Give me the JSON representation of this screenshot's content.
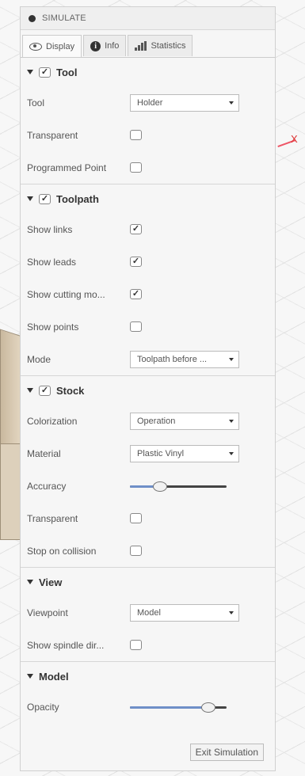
{
  "panel_title": "SIMULATE",
  "tabs": [
    {
      "label": "Display",
      "icon": "eye-icon"
    },
    {
      "label": "Info",
      "icon": "info-icon"
    },
    {
      "label": "Statistics",
      "icon": "bar-chart-icon"
    }
  ],
  "viewport": {
    "axis_label": "X"
  },
  "tool": {
    "title": "Tool",
    "checked": true,
    "tool_label": "Tool",
    "tool_value": "Holder",
    "transparent_label": "Transparent",
    "programmed_point_label": "Programmed Point"
  },
  "toolpath": {
    "title": "Toolpath",
    "checked": true,
    "show_links_label": "Show links",
    "show_leads_label": "Show leads",
    "show_cutting_label": "Show cutting mo...",
    "show_points_label": "Show points",
    "mode_label": "Mode",
    "mode_value": "Toolpath before ..."
  },
  "stock": {
    "title": "Stock",
    "checked": true,
    "colorization_label": "Colorization",
    "colorization_value": "Operation",
    "material_label": "Material",
    "material_value": "Plastic Vinyl",
    "accuracy_label": "Accuracy",
    "accuracy_fraction": 0.3,
    "transparent_label": "Transparent",
    "stop_on_collision_label": "Stop on collision"
  },
  "view": {
    "title": "View",
    "viewpoint_label": "Viewpoint",
    "viewpoint_value": "Model",
    "show_spindle_label": "Show spindle dir..."
  },
  "model": {
    "title": "Model",
    "opacity_label": "Opacity",
    "opacity_fraction": 0.8
  },
  "exit_label": "Exit Simulation",
  "colors": {
    "slider_fill": "#6f8fc8",
    "accent_x": "#dd3333"
  }
}
